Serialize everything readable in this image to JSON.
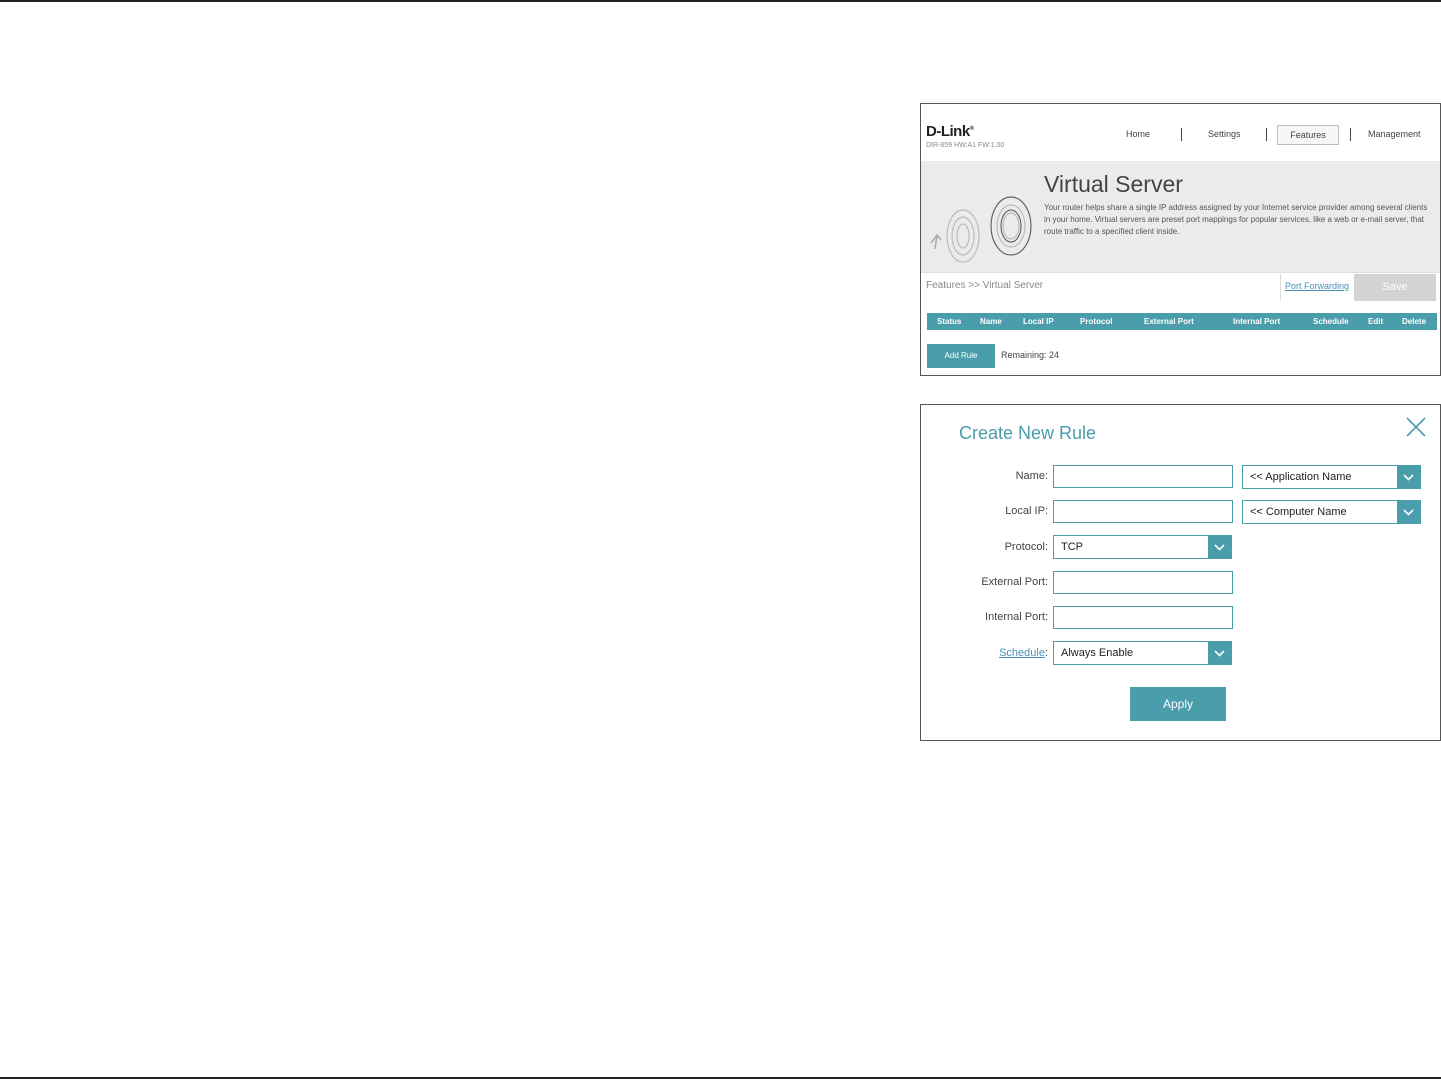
{
  "router_page": {
    "logo": "D-Link",
    "firmware": "DIR-859 HW:A1 FW:1.00",
    "nav": [
      "Home",
      "Settings",
      "Features",
      "Management"
    ],
    "title": "Virtual Server",
    "description": "Your router helps share a single IP address assigned by your Internet service provider among several clients in your home. Virtual servers are preset port mappings for popular services, like a web or e-mail server, that route traffic to a specified client inside.",
    "breadcrumb": "Features >> Virtual Server",
    "port_forwarding_link": "Port Forwarding",
    "save_label": "Save",
    "table_headers": [
      "Status",
      "Name",
      "Local IP",
      "Protocol",
      "External Port",
      "Internal Port",
      "Schedule",
      "Edit",
      "Delete"
    ],
    "add_rule_label": "Add Rule",
    "remaining": "Remaining: 24"
  },
  "dialog": {
    "title": "Create New Rule",
    "fields": {
      "name_label": "Name",
      "name_value": "",
      "app_select": "<< Application Name",
      "local_ip_label": "Local IP",
      "local_ip_value": "",
      "computer_select": "<< Computer Name",
      "protocol_label": "Protocol",
      "protocol_value": "TCP",
      "external_port_label": "External Port",
      "external_port_value": "",
      "internal_port_label": "Internal Port",
      "internal_port_value": "",
      "schedule_label": "Schedule",
      "schedule_value": "Always Enable"
    },
    "apply_label": "Apply"
  },
  "colors": {
    "accent": "#4a9dab",
    "link": "#4a90b8"
  },
  "icons": [
    "close-icon",
    "chevron-down-icon"
  ]
}
